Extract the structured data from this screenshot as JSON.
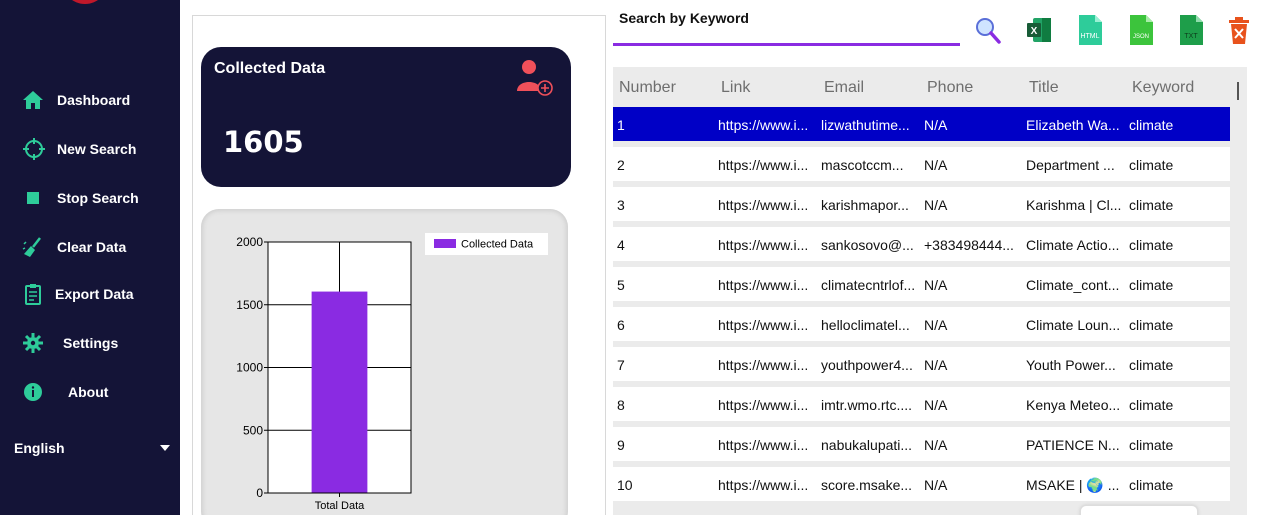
{
  "sidebar": {
    "items": [
      {
        "label": "Dashboard",
        "icon": "home-icon"
      },
      {
        "label": "New Search",
        "icon": "crosshair-icon"
      },
      {
        "label": "Stop Search",
        "icon": "stop-icon"
      },
      {
        "label": "Clear Data",
        "icon": "broom-icon"
      },
      {
        "label": "Export Data",
        "icon": "clipboard-icon"
      },
      {
        "label": "Settings",
        "icon": "gear-icon"
      },
      {
        "label": "About",
        "icon": "info-icon"
      }
    ],
    "language": "English",
    "accent": "#2ecc9a"
  },
  "stat_card": {
    "title": "Collected Data",
    "value": "1605",
    "icon": "add-user-icon"
  },
  "chart_data": {
    "type": "bar",
    "categories": [
      "Total Data"
    ],
    "series": [
      {
        "name": "Collected Data",
        "values": [
          1605
        ]
      }
    ],
    "ylim": [
      0,
      2000
    ],
    "yticks": [
      0,
      500,
      1000,
      1500,
      2000
    ],
    "grid": true,
    "legend": "top-right",
    "color": "#8a2be2"
  },
  "search": {
    "label": "Search by Keyword",
    "value": "",
    "placeholder": ""
  },
  "toolbar": [
    {
      "icon": "search-icon",
      "label": ""
    },
    {
      "icon": "excel-icon",
      "label": ""
    },
    {
      "icon": "html-icon",
      "label": "HTML"
    },
    {
      "icon": "json-icon",
      "label": "JSON"
    },
    {
      "icon": "txt-icon",
      "label": "TXT"
    },
    {
      "icon": "delete-icon",
      "label": ""
    }
  ],
  "table": {
    "columns": [
      "Number",
      "Link",
      "Email",
      "Phone",
      "Title",
      "Keyword"
    ],
    "rows": [
      [
        "1",
        "https://www.i...",
        "lizwathutime...",
        "N/A",
        "Elizabeth Wa...",
        "climate"
      ],
      [
        "2",
        "https://www.i...",
        "mascotccm...",
        "N/A",
        "Department ...",
        "climate"
      ],
      [
        "3",
        "https://www.i...",
        "karishmapor...",
        "N/A",
        "Karishma | Cl...",
        "climate"
      ],
      [
        "4",
        "https://www.i...",
        "sankosovo@...",
        "+383498444...",
        "Climate Actio...",
        "climate"
      ],
      [
        "5",
        "https://www.i...",
        "climatecntrlof...",
        "N/A",
        "Climate_cont...",
        "climate"
      ],
      [
        "6",
        "https://www.i...",
        "helloclimatel...",
        "N/A",
        "Climate Loun...",
        "climate"
      ],
      [
        "7",
        "https://www.i...",
        "youthpower4...",
        "N/A",
        "Youth Power...",
        "climate"
      ],
      [
        "8",
        "https://www.i...",
        "imtr.wmo.rtc....",
        "N/A",
        "Kenya Meteo...",
        "climate"
      ],
      [
        "9",
        "https://www.i...",
        "nabukalupati...",
        "N/A",
        "PATIENCE N...",
        "climate"
      ],
      [
        "10",
        "https://www.i...",
        "score.msake...",
        "N/A",
        "MSAKE | 🌍 ...",
        "climate"
      ]
    ],
    "selected_row": 0
  }
}
